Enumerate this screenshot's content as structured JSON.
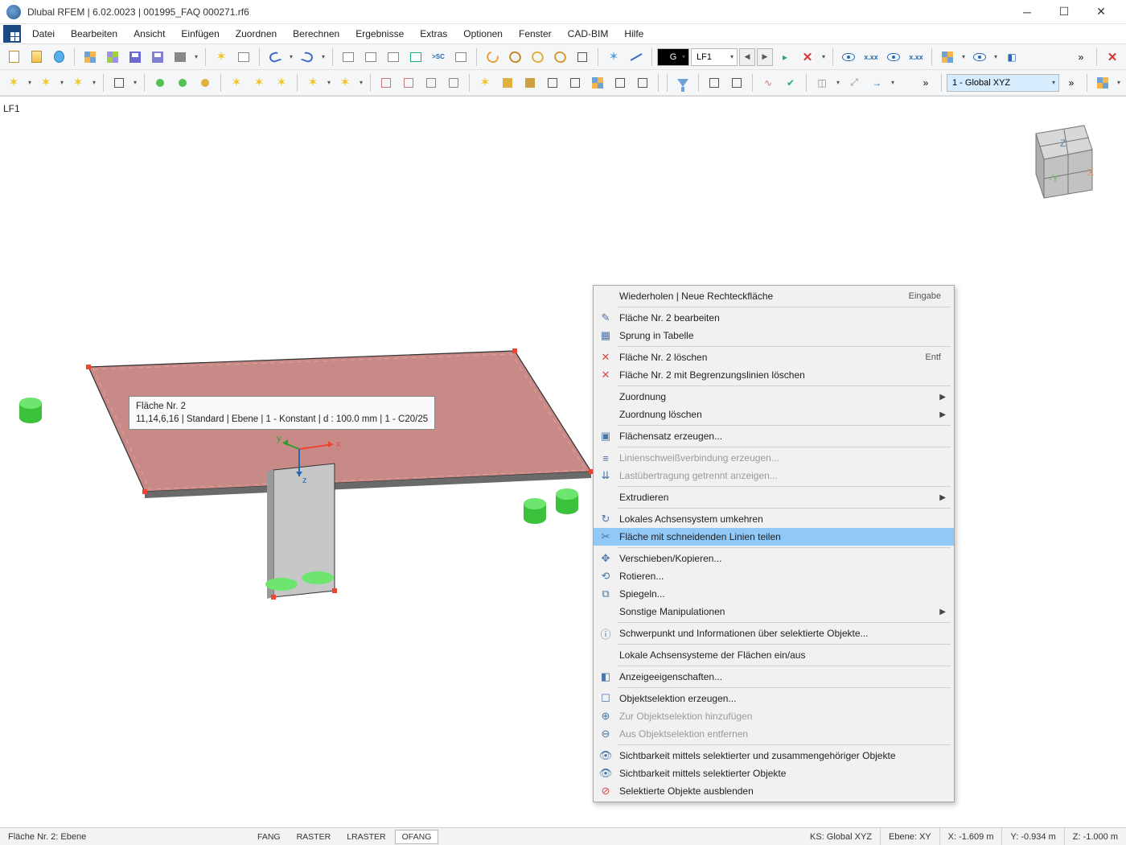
{
  "window": {
    "title": "Dlubal RFEM | 6.02.0023 | 001995_FAQ 000271.rf6"
  },
  "menu": {
    "items": [
      "Datei",
      "Bearbeiten",
      "Ansicht",
      "Einfügen",
      "Zuordnen",
      "Berechnen",
      "Ergebnisse",
      "Extras",
      "Optionen",
      "Fenster",
      "CAD-BIM",
      "Hilfe"
    ]
  },
  "toolbar": {
    "combo_g": "G",
    "combo_lf": "LF1",
    "combo_coord": "1 - Global XYZ"
  },
  "viewport": {
    "loadcase_label": "LF1",
    "tooltip_line1": "Fläche Nr. 2",
    "tooltip_line2": "11,14,6,16 | Standard | Ebene | 1 - Konstant | d : 100.0 mm | 1 - C20/25",
    "axes": {
      "x": "x",
      "y": "y",
      "z": "z"
    },
    "cube": {
      "x": "X",
      "y": "-Y",
      "z": "Z"
    }
  },
  "context_menu": {
    "items": [
      {
        "label": "Wiederholen | Neue Rechteckfläche",
        "shortcut": "Eingabe"
      },
      {
        "sep": true
      },
      {
        "label": "Fläche Nr. 2 bearbeiten",
        "icon": "edit"
      },
      {
        "label": "Sprung in Tabelle",
        "icon": "table"
      },
      {
        "sep": true
      },
      {
        "label": "Fläche Nr. 2 löschen",
        "shortcut": "Entf",
        "icon": "delete"
      },
      {
        "label": "Fläche Nr. 2 mit Begrenzungslinien löschen",
        "icon": "delete"
      },
      {
        "sep": true
      },
      {
        "label": "Zuordnung",
        "arrow": true
      },
      {
        "label": "Zuordnung löschen",
        "arrow": true
      },
      {
        "sep": true
      },
      {
        "label": "Flächensatz erzeugen...",
        "icon": "set"
      },
      {
        "sep": true
      },
      {
        "label": "Linienschweißverbindung erzeugen...",
        "disabled": true,
        "icon": "weld"
      },
      {
        "label": "Lastübertragung getrennt anzeigen...",
        "disabled": true,
        "icon": "load"
      },
      {
        "sep": true
      },
      {
        "label": "Extrudieren",
        "arrow": true
      },
      {
        "sep": true
      },
      {
        "label": "Lokales Achsensystem umkehren",
        "icon": "axes"
      },
      {
        "label": "Fläche mit schneidenden Linien teilen",
        "icon": "cut",
        "highlight": true
      },
      {
        "sep": true
      },
      {
        "label": "Verschieben/Kopieren...",
        "icon": "move"
      },
      {
        "label": "Rotieren...",
        "icon": "rotate"
      },
      {
        "label": "Spiegeln...",
        "icon": "mirror"
      },
      {
        "label": "Sonstige Manipulationen",
        "arrow": true
      },
      {
        "sep": true
      },
      {
        "label": "Schwerpunkt und Informationen über selektierte Objekte...",
        "icon": "info"
      },
      {
        "sep": true
      },
      {
        "label": "Lokale Achsensysteme der Flächen ein/aus"
      },
      {
        "sep": true
      },
      {
        "label": "Anzeigeeigenschaften...",
        "icon": "display"
      },
      {
        "sep": true
      },
      {
        "label": "Objektselektion erzeugen...",
        "icon": "sel"
      },
      {
        "label": "Zur Objektselektion hinzufügen",
        "disabled": true,
        "icon": "seladd"
      },
      {
        "label": "Aus Objektselektion entfernen",
        "disabled": true,
        "icon": "selrem"
      },
      {
        "sep": true
      },
      {
        "label": "Sichtbarkeit mittels selektierter und zusammengehöriger Objekte",
        "icon": "vis"
      },
      {
        "label": "Sichtbarkeit mittels selektierter Objekte",
        "icon": "vis"
      },
      {
        "label": "Selektierte Objekte ausblenden",
        "icon": "hide"
      }
    ]
  },
  "status": {
    "info": "Fläche Nr. 2: Ebene",
    "toggles": [
      "FANG",
      "RASTER",
      "LRASTER",
      "OFANG"
    ],
    "active_toggle": "OFANG",
    "cs": "KS: Global XYZ",
    "plane": "Ebene: XY",
    "x": "X: -1.609 m",
    "y": "Y: -0.934 m",
    "z": "Z: -1.000 m"
  }
}
